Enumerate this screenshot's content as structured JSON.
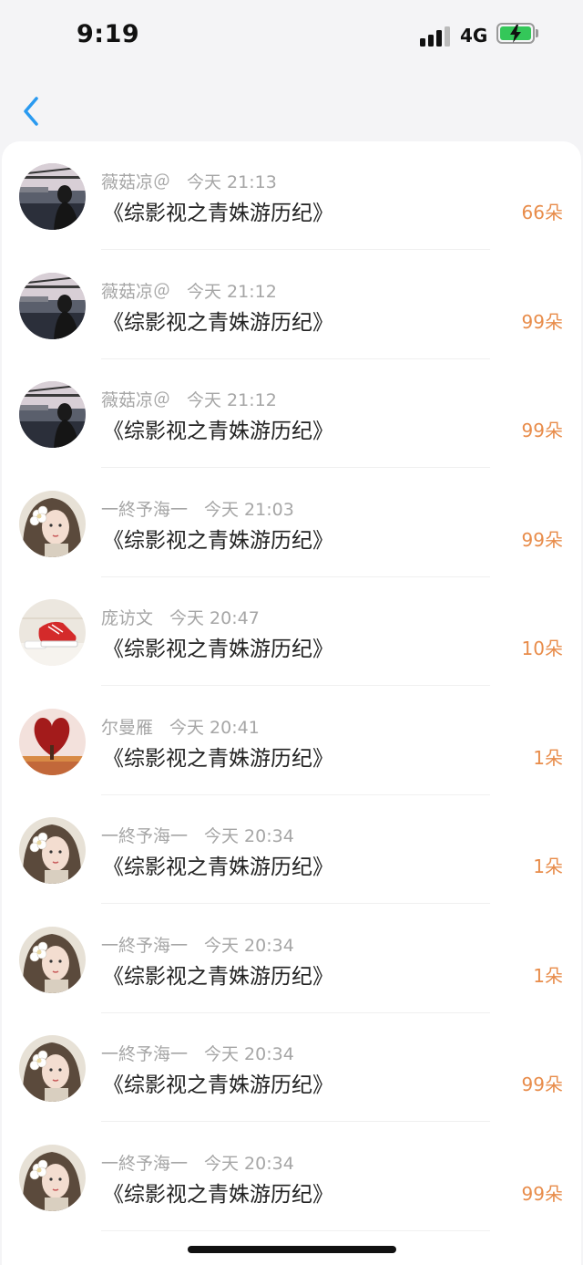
{
  "status_bar": {
    "time": "9:19",
    "network": "4G"
  },
  "nav": {
    "back_icon": "chevron-left-icon"
  },
  "items": [
    {
      "user": "薇菇凉＠",
      "time": "今天 21:13",
      "title": "《综影视之青姝游历纪》",
      "count": "66朵",
      "avatar": "woman-by-water-avatar"
    },
    {
      "user": "薇菇凉＠",
      "time": "今天 21:12",
      "title": "《综影视之青姝游历纪》",
      "count": "99朵",
      "avatar": "woman-by-water-avatar"
    },
    {
      "user": "薇菇凉＠",
      "time": "今天 21:12",
      "title": "《综影视之青姝游历纪》",
      "count": "99朵",
      "avatar": "woman-by-water-avatar"
    },
    {
      "user": "一終予海一",
      "time": "今天 21:03",
      "title": "《综影视之青姝游历纪》",
      "count": "99朵",
      "avatar": "flower-girl-avatar"
    },
    {
      "user": "庞访文",
      "time": "今天 20:47",
      "title": "《综影视之青姝游历纪》",
      "count": "10朵",
      "avatar": "red-sneakers-avatar"
    },
    {
      "user": "尔曼雁",
      "time": "今天 20:41",
      "title": "《综影视之青姝游历纪》",
      "count": "1朵",
      "avatar": "heart-tree-avatar"
    },
    {
      "user": "一終予海一",
      "time": "今天 20:34",
      "title": "《综影视之青姝游历纪》",
      "count": "1朵",
      "avatar": "flower-girl-avatar"
    },
    {
      "user": "一終予海一",
      "time": "今天 20:34",
      "title": "《综影视之青姝游历纪》",
      "count": "1朵",
      "avatar": "flower-girl-avatar"
    },
    {
      "user": "一終予海一",
      "time": "今天 20:34",
      "title": "《综影视之青姝游历纪》",
      "count": "99朵",
      "avatar": "flower-girl-avatar"
    },
    {
      "user": "一終予海一",
      "time": "今天 20:34",
      "title": "《综影视之青姝游历纪》",
      "count": "99朵",
      "avatar": "flower-girl-avatar"
    }
  ]
}
